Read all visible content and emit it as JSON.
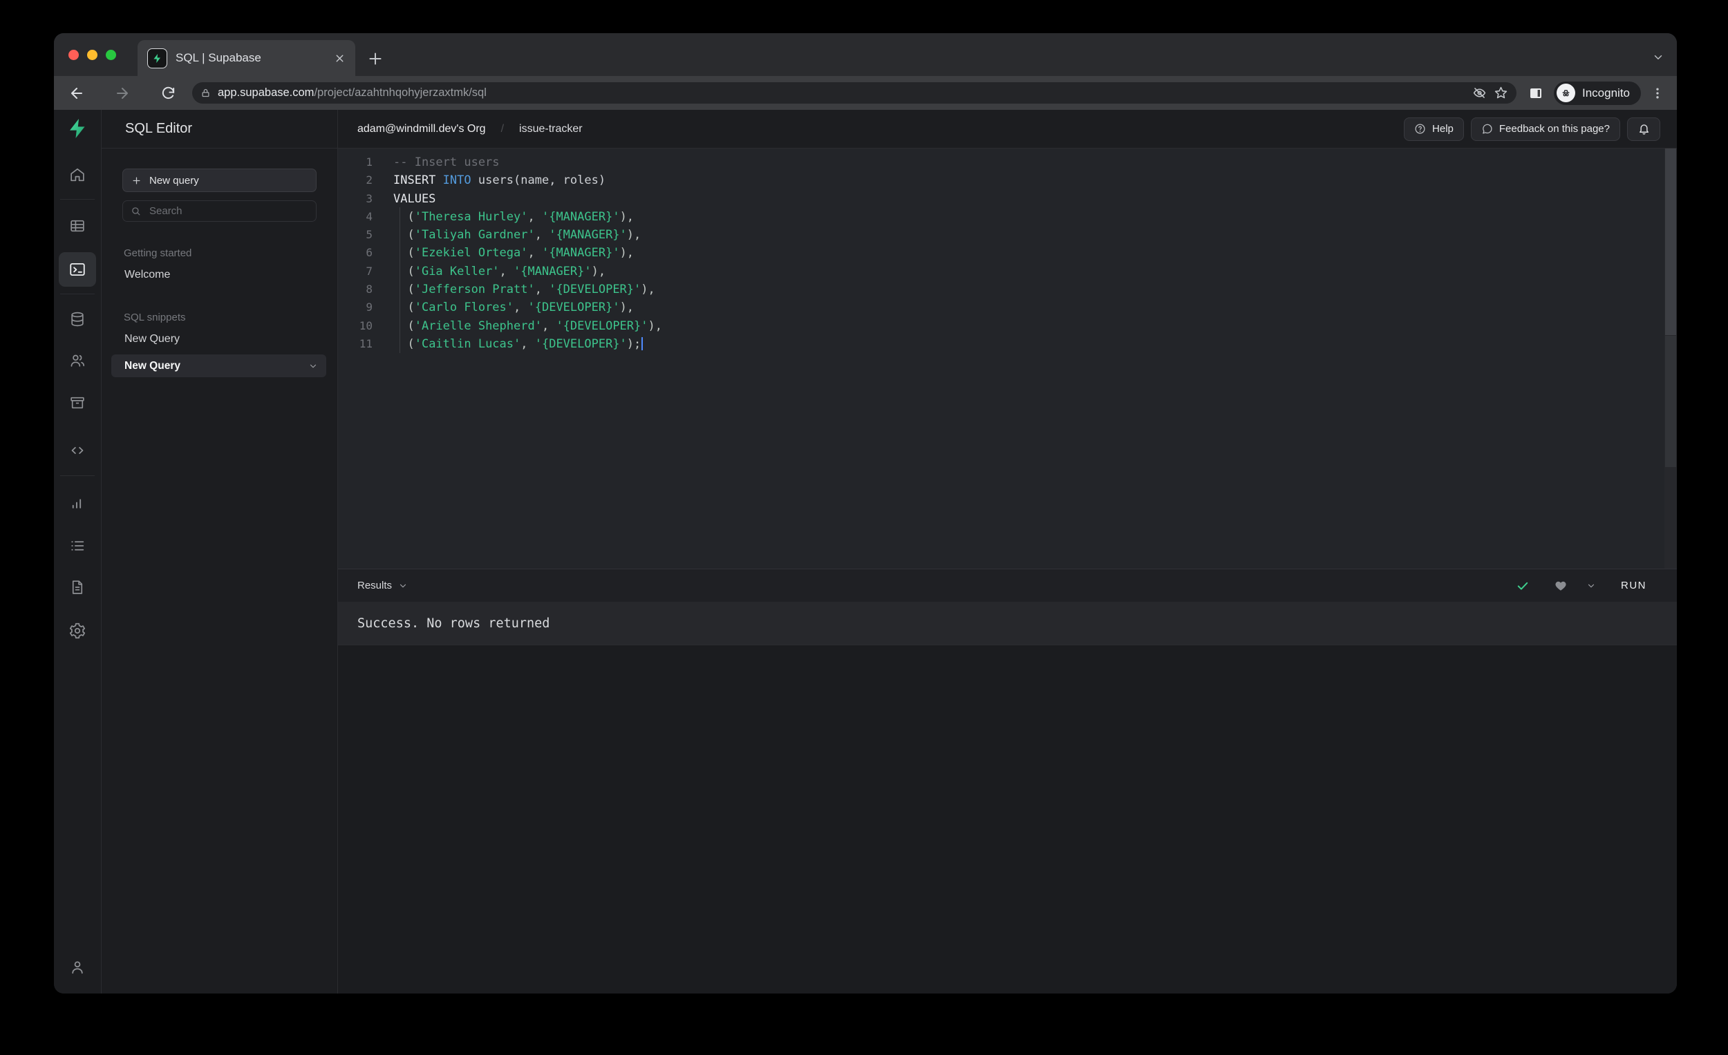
{
  "browser": {
    "tab": {
      "title": "SQL | Supabase"
    },
    "url_host": "app.supabase.com",
    "url_path": "/project/azahtnhqohyjerzaxtmk/sql",
    "incognito_label": "Incognito",
    "traffic_colors": {
      "close": "#ff5f57",
      "minimize": "#febc2e",
      "zoom": "#28c840"
    }
  },
  "header": {
    "app_title": "SQL Editor",
    "breadcrumb": {
      "org": "adam@windmill.dev's Org",
      "sep": "/",
      "project": "issue-tracker"
    },
    "help_label": "Help",
    "feedback_label": "Feedback on this page?"
  },
  "sidebar": {
    "new_query_button": "New query",
    "search_placeholder": "Search",
    "sections": [
      {
        "label": "Getting started",
        "items": [
          {
            "label": "Welcome",
            "active": false
          }
        ]
      },
      {
        "label": "SQL snippets",
        "items": [
          {
            "label": "New Query",
            "active": false
          },
          {
            "label": "New Query",
            "active": true
          }
        ]
      }
    ]
  },
  "rail_icons": [
    "home",
    "table-editor",
    "sql-editor",
    "database",
    "auth-users",
    "storage",
    "edge-functions",
    "reports",
    "logs",
    "docs",
    "settings",
    "account"
  ],
  "editor": {
    "lines": [
      {
        "n": "1",
        "segs": [
          [
            "comment",
            "-- Insert users"
          ]
        ]
      },
      {
        "n": "2",
        "segs": [
          [
            "kw",
            "INSERT "
          ],
          [
            "kw2",
            "INTO"
          ],
          [
            "plain",
            " users(name, roles)"
          ]
        ]
      },
      {
        "n": "3",
        "segs": [
          [
            "kw",
            "VALUES"
          ]
        ]
      },
      {
        "n": "4",
        "segs": [
          [
            "punct",
            "  ("
          ],
          [
            "str",
            "'Theresa Hurley'"
          ],
          [
            "punct",
            ", "
          ],
          [
            "str",
            "'{MANAGER}'"
          ],
          [
            "punct",
            "),"
          ]
        ]
      },
      {
        "n": "5",
        "segs": [
          [
            "punct",
            "  ("
          ],
          [
            "str",
            "'Taliyah Gardner'"
          ],
          [
            "punct",
            ", "
          ],
          [
            "str",
            "'{MANAGER}'"
          ],
          [
            "punct",
            "),"
          ]
        ]
      },
      {
        "n": "6",
        "segs": [
          [
            "punct",
            "  ("
          ],
          [
            "str",
            "'Ezekiel Ortega'"
          ],
          [
            "punct",
            ", "
          ],
          [
            "str",
            "'{MANAGER}'"
          ],
          [
            "punct",
            "),"
          ]
        ]
      },
      {
        "n": "7",
        "segs": [
          [
            "punct",
            "  ("
          ],
          [
            "str",
            "'Gia Keller'"
          ],
          [
            "punct",
            ", "
          ],
          [
            "str",
            "'{MANAGER}'"
          ],
          [
            "punct",
            "),"
          ]
        ]
      },
      {
        "n": "8",
        "segs": [
          [
            "punct",
            "  ("
          ],
          [
            "str",
            "'Jefferson Pratt'"
          ],
          [
            "punct",
            ", "
          ],
          [
            "str",
            "'{DEVELOPER}'"
          ],
          [
            "punct",
            "),"
          ]
        ]
      },
      {
        "n": "9",
        "segs": [
          [
            "punct",
            "  ("
          ],
          [
            "str",
            "'Carlo Flores'"
          ],
          [
            "punct",
            ", "
          ],
          [
            "str",
            "'{DEVELOPER}'"
          ],
          [
            "punct",
            "),"
          ]
        ]
      },
      {
        "n": "10",
        "segs": [
          [
            "punct",
            "  ("
          ],
          [
            "str",
            "'Arielle Shepherd'"
          ],
          [
            "punct",
            ", "
          ],
          [
            "str",
            "'{DEVELOPER}'"
          ],
          [
            "punct",
            "),"
          ]
        ]
      },
      {
        "n": "11",
        "cursor": true,
        "segs": [
          [
            "punct",
            "  ("
          ],
          [
            "str",
            "'Caitlin Lucas'"
          ],
          [
            "punct",
            ", "
          ],
          [
            "str",
            "'{DEVELOPER}'"
          ],
          [
            "punct",
            ");"
          ]
        ]
      }
    ]
  },
  "results": {
    "label": "Results",
    "run_label": "RUN",
    "message": "Success. No rows returned"
  },
  "colors": {
    "accent_green": "#3ecf8e",
    "keyword_blue": "#539bdd",
    "string_green": "#3dc48c",
    "cursor_blue": "#4f8bff"
  }
}
